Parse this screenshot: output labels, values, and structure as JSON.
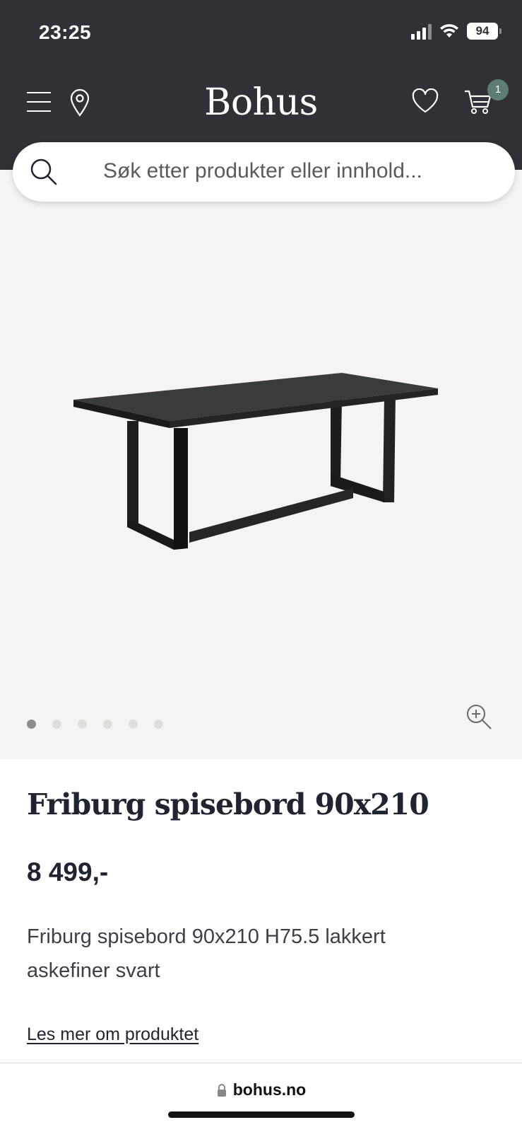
{
  "status_bar": {
    "time": "23:25",
    "battery": "94"
  },
  "header": {
    "logo": "Bohus",
    "cart_count": "1"
  },
  "search": {
    "placeholder": "Søk etter produkter eller innhold..."
  },
  "gallery": {
    "dots_total": 6,
    "active_index": 0
  },
  "product": {
    "title": "Friburg spisebord 90x210",
    "price": "8 499,-",
    "description": "Friburg spisebord 90x210 H75.5 lakkert askefiner svart",
    "read_more": "Les mer om produktet"
  },
  "browser": {
    "url": "bohus.no"
  },
  "colors": {
    "header_bg": "#303036",
    "badge": "#5d7c78",
    "gallery_bg": "#f5f4f2"
  }
}
